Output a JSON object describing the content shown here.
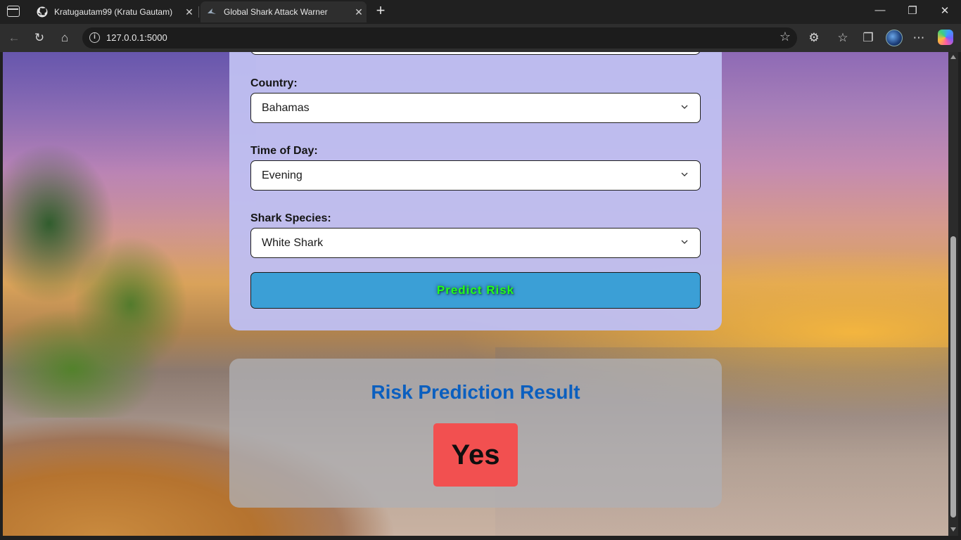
{
  "browser": {
    "tabs": [
      {
        "title": "Kratugautam99 (Kratu Gautam)",
        "icon": "github-icon",
        "active": false
      },
      {
        "title": "Global Shark Attack Warner",
        "icon": "shark-icon",
        "active": true
      }
    ],
    "url": "127.0.0.1:5000",
    "new_tab_label": "+",
    "close_label": "✕",
    "window_controls": {
      "minimize": "—",
      "maximize": "❐",
      "close": "✕"
    }
  },
  "form": {
    "country": {
      "label": "Country:",
      "value": "Bahamas"
    },
    "time_of_day": {
      "label": "Time of Day:",
      "value": "Evening"
    },
    "shark_species": {
      "label": "Shark Species:",
      "value": "White Shark"
    },
    "predict_button": "Predict Risk"
  },
  "result": {
    "title": "Risk Prediction Result",
    "value": "Yes",
    "value_color": "#f25050"
  },
  "colors": {
    "title_blue": "#0b5fbf",
    "button_bg": "#3b9fd6",
    "button_text": "#22ff1a",
    "form_card": "#bebef0"
  }
}
